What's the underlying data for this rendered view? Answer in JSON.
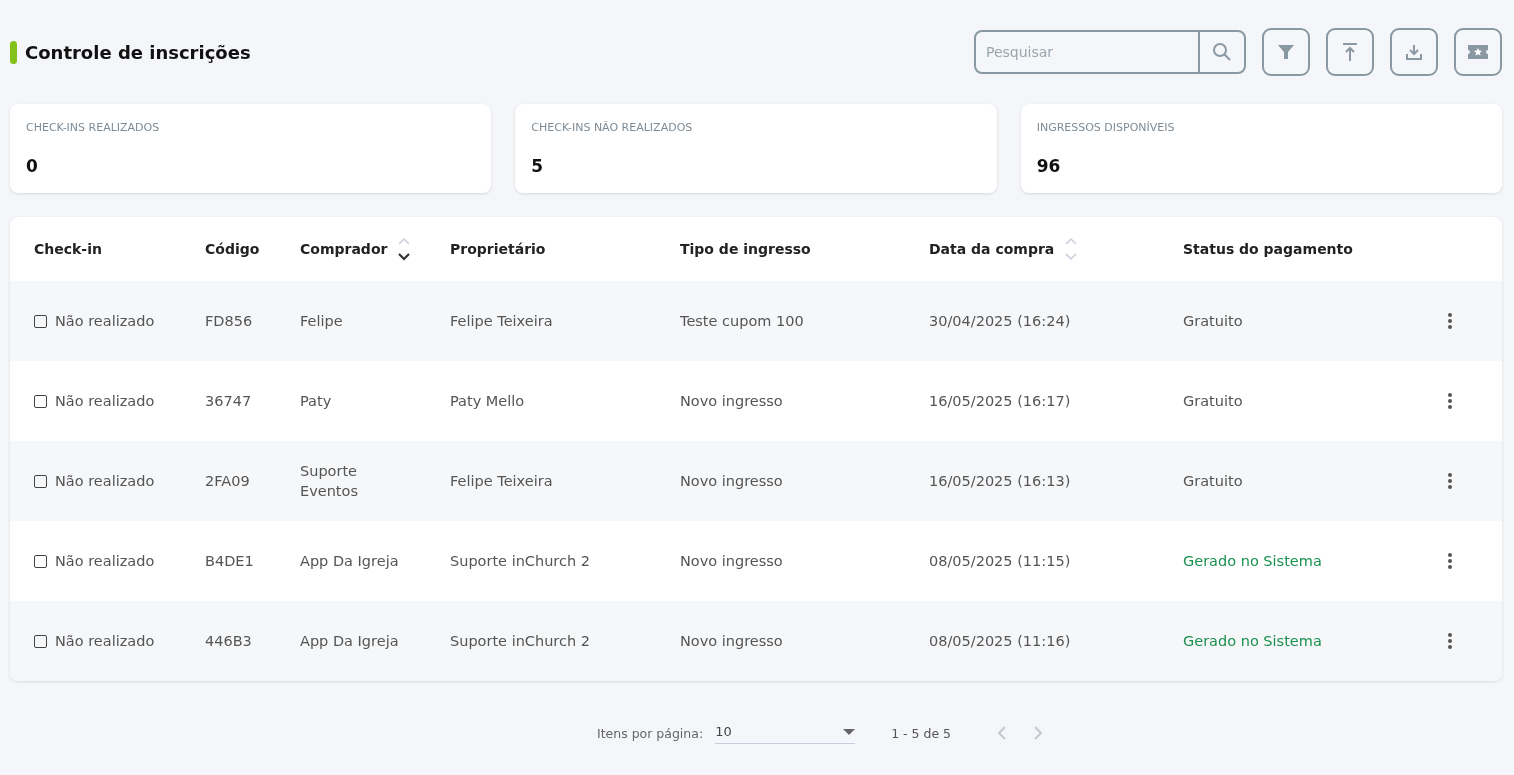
{
  "header": {
    "title": "Controle de inscrições"
  },
  "toolbar": {
    "search": {
      "placeholder": "Pesquisar"
    }
  },
  "stats": [
    {
      "label": "CHECK-INS REALIZADOS",
      "value": "0"
    },
    {
      "label": "CHECK-INS NÃO REALIZADOS",
      "value": "5"
    },
    {
      "label": "INGRESSOS DISPONÍVEIS",
      "value": "96"
    }
  ],
  "table": {
    "columns": [
      {
        "label": "Check-in",
        "sortable": false,
        "sorted": false
      },
      {
        "label": "Código",
        "sortable": false,
        "sorted": false
      },
      {
        "label": "Comprador",
        "sortable": true,
        "sorted": true
      },
      {
        "label": "Proprietário",
        "sortable": false,
        "sorted": false
      },
      {
        "label": "Tipo de ingresso",
        "sortable": false,
        "sorted": false
      },
      {
        "label": "Data da compra",
        "sortable": true,
        "sorted": false
      },
      {
        "label": "Status do pagamento",
        "sortable": false,
        "sorted": false
      }
    ],
    "rows": [
      {
        "checked": false,
        "checkin": "Não realizado",
        "code": "FD856",
        "buyer": "Felipe",
        "owner": "Felipe Teixeira",
        "ticket": "Teste cupom 100",
        "date": "30/04/2025 (16:24)",
        "status": "Gratuito",
        "color": "#555555"
      },
      {
        "checked": false,
        "checkin": "Não realizado",
        "code": "36747",
        "buyer": "Paty",
        "owner": "Paty Mello",
        "ticket": "Novo ingresso",
        "date": "16/05/2025 (16:17)",
        "status": "Gratuito",
        "color": "#555555"
      },
      {
        "checked": false,
        "checkin": "Não realizado",
        "code": "2FA09",
        "buyer": "Suporte Eventos",
        "owner": "Felipe Teixeira",
        "ticket": "Novo ingresso",
        "date": "16/05/2025 (16:13)",
        "status": "Gratuito",
        "color": "#555555"
      },
      {
        "checked": false,
        "checkin": "Não realizado",
        "code": "B4DE1",
        "buyer": "App Da Igreja",
        "owner": "Suporte inChurch 2",
        "ticket": "Novo ingresso",
        "date": "08/05/2025 (11:15)",
        "status": "Gerado no Sistema",
        "color": "#1a9150"
      },
      {
        "checked": false,
        "checkin": "Não realizado",
        "code": "446B3",
        "buyer": "App Da Igreja",
        "owner": "Suporte inChurch 2",
        "ticket": "Novo ingresso",
        "date": "08/05/2025 (11:16)",
        "status": "Gerado no Sistema",
        "color": "#1a9150"
      }
    ]
  },
  "pagination": {
    "label": "Itens por página:",
    "page_size": "10",
    "range": "1 - 5 de 5",
    "prev": {
      "disabled": true
    },
    "next": {
      "disabled": true
    }
  }
}
